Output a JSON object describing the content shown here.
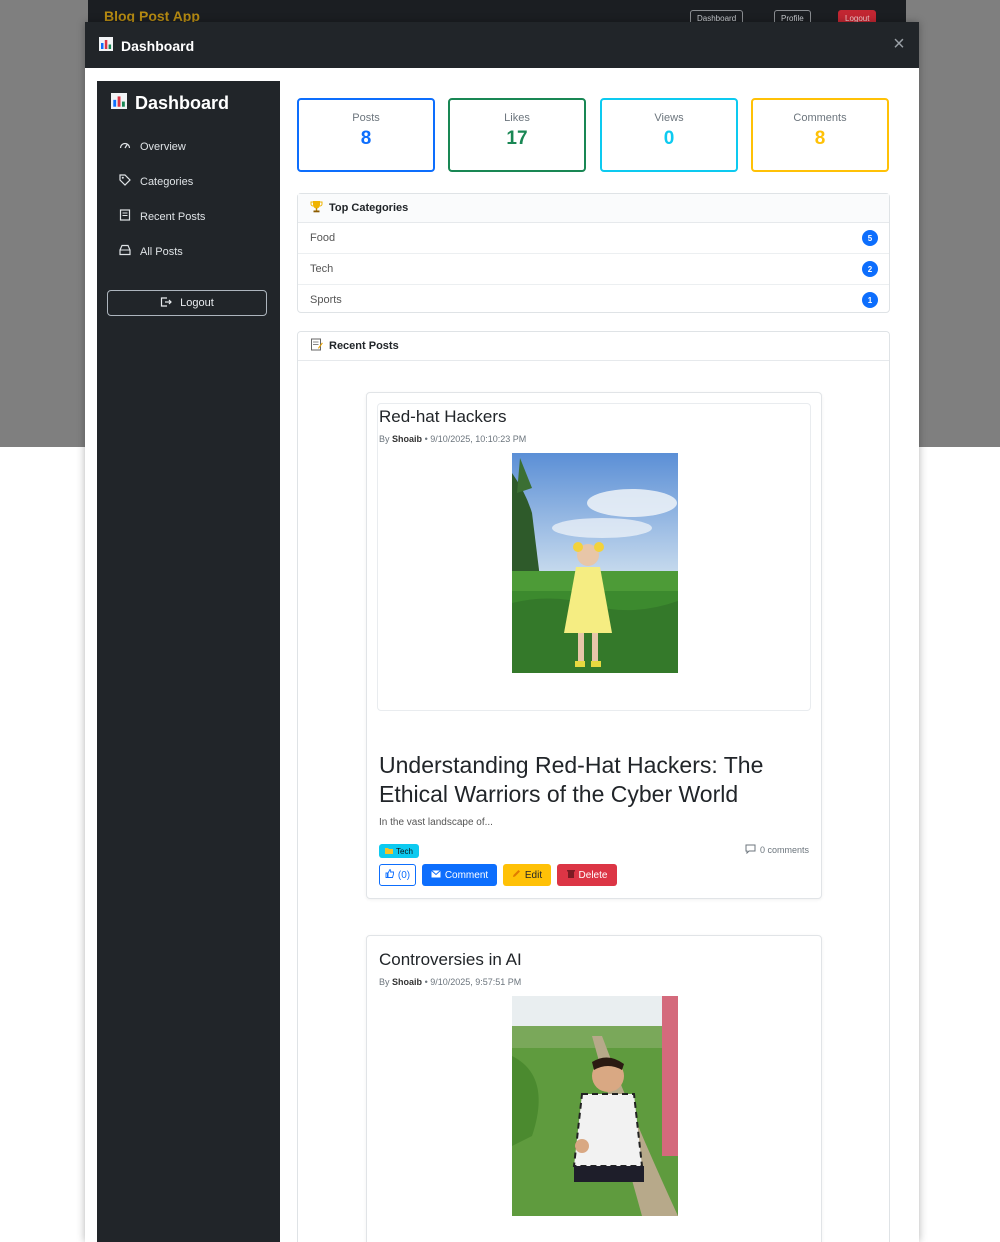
{
  "background": {
    "app_brand": "Blog Post App",
    "nav_buttons": [
      "Dashboard",
      "Profile",
      "Logout"
    ]
  },
  "modal": {
    "title": "Dashboard",
    "close_label": "×"
  },
  "sidebar": {
    "title": "Dashboard",
    "items": [
      {
        "label": "Overview",
        "icon": "speedometer-icon"
      },
      {
        "label": "Categories",
        "icon": "tag-icon"
      },
      {
        "label": "Recent Posts",
        "icon": "document-icon"
      },
      {
        "label": "All Posts",
        "icon": "inbox-icon"
      }
    ],
    "logout_label": "Logout"
  },
  "stats": [
    {
      "label": "Posts",
      "value": "8",
      "color": "#0d6efd"
    },
    {
      "label": "Likes",
      "value": "17",
      "color": "#198754"
    },
    {
      "label": "Views",
      "value": "0",
      "color": "#0dcaf0"
    },
    {
      "label": "Comments",
      "value": "8",
      "color": "#ffc107"
    }
  ],
  "top_categories": {
    "title": "Top Categories",
    "rows": [
      {
        "name": "Food",
        "count": "5"
      },
      {
        "name": "Tech",
        "count": "2"
      },
      {
        "name": "Sports",
        "count": "1"
      }
    ]
  },
  "recent_posts": {
    "title": "Recent Posts",
    "posts": [
      {
        "title": "Red-hat Hackers",
        "by": "By",
        "author": "Shoaib",
        "date": "• 9/10/2025, 10:10:23 PM",
        "heading": "Understanding Red-Hat Hackers: The Ethical Warriors of the Cyber World",
        "excerpt": "In the vast landscape of...",
        "tag": "Tech",
        "comments": "0 comments",
        "like_label": "(0)",
        "comment_label": "Comment",
        "edit_label": "Edit",
        "delete_label": "Delete"
      },
      {
        "title": "Controversies in AI",
        "by": "By",
        "author": "Shoaib",
        "date": "• 9/10/2025, 9:57:51 PM"
      }
    ]
  },
  "colors": {
    "dark": "#212529",
    "primary": "#0d6efd",
    "warning": "#ffc107",
    "danger": "#dc3545",
    "info": "#0dcaf0"
  }
}
